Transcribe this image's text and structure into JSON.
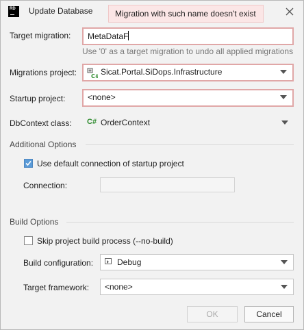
{
  "window": {
    "app_icon_text": "RD",
    "title": "Update Database",
    "error_tooltip": "Migration with such name doesn't exist"
  },
  "target_migration": {
    "label": "Target migration:",
    "value": "MetaDataF",
    "hint": "Use '0' as a target migration to undo all applied migrations"
  },
  "migrations_project": {
    "label": "Migrations project:",
    "value": "Sicat.Portal.SiDops.Infrastructure"
  },
  "startup_project": {
    "label": "Startup project:",
    "value": "<none>"
  },
  "dbcontext": {
    "label": "DbContext class:",
    "icon_text": "C#",
    "value": "OrderContext"
  },
  "additional_options": {
    "header": "Additional Options",
    "use_default_label": "Use default connection of startup project",
    "use_default_checked": true,
    "connection_label": "Connection:",
    "connection_value": ""
  },
  "build_options": {
    "header": "Build Options",
    "skip_build_label": "Skip project build process (--no-build)",
    "skip_build_checked": false,
    "build_config_label": "Build configuration:",
    "build_config_value": "Debug",
    "target_framework_label": "Target framework:",
    "target_framework_value": "<none>"
  },
  "buttons": {
    "ok": "OK",
    "cancel": "Cancel"
  }
}
